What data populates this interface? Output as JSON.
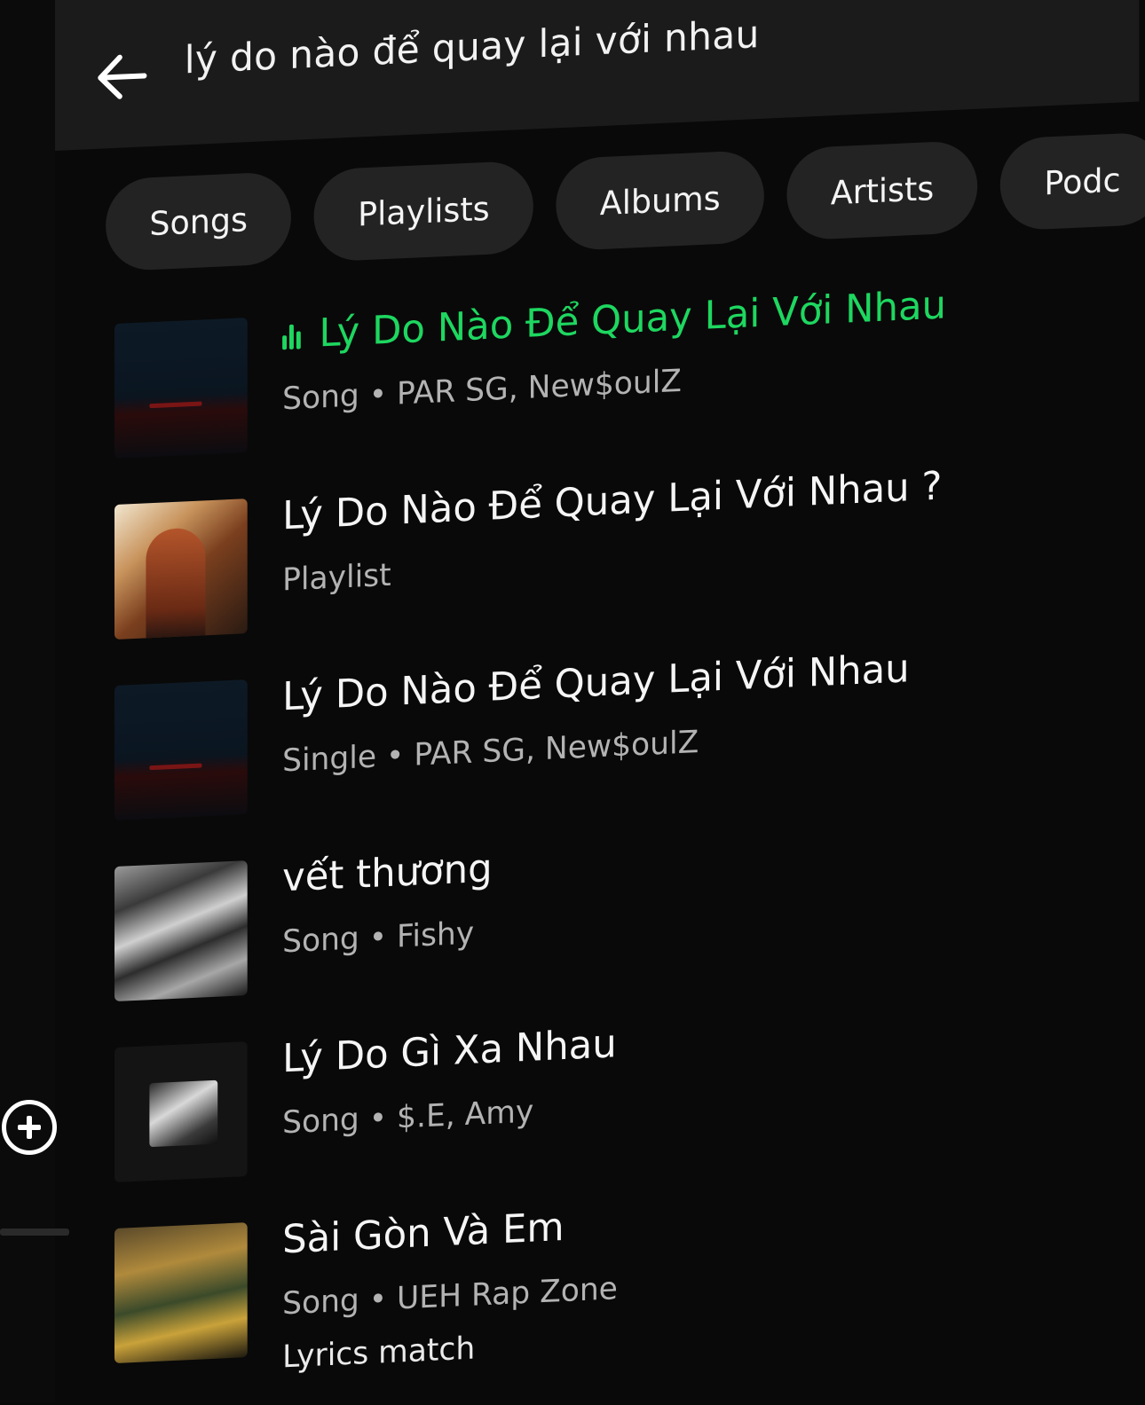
{
  "search": {
    "query": "lý do nào để quay lại với nhau"
  },
  "filters": [
    {
      "label": "Songs"
    },
    {
      "label": "Playlists"
    },
    {
      "label": "Albums"
    },
    {
      "label": "Artists"
    },
    {
      "label": "Podc"
    }
  ],
  "results": [
    {
      "title": "Lý Do Nào Để Quay Lại Với Nhau",
      "subtitle": "Song • PAR SG, New$oulZ",
      "playing": true
    },
    {
      "title": "Lý Do Nào Để Quay Lại Với Nhau ?",
      "subtitle": "Playlist"
    },
    {
      "title": "Lý Do Nào Để Quay Lại Với Nhau",
      "subtitle": "Single • PAR SG, New$oulZ"
    },
    {
      "title": "vết thương",
      "subtitle": "Song • Fishy"
    },
    {
      "title": "Lý Do Gì Xa Nhau",
      "subtitle": "Song • $.E, Amy"
    },
    {
      "title": "Sài Gòn Và Em",
      "subtitle": "Song • UEH Rap Zone",
      "extra": "Lyrics match"
    }
  ],
  "colors": {
    "accent": "#1ed760",
    "background": "#090909",
    "chip": "#232323",
    "subtitle": "#b3b3b3"
  },
  "icons": {
    "back": "arrow-left-icon",
    "playing": "equalizer-icon",
    "add": "plus-circle-icon"
  }
}
